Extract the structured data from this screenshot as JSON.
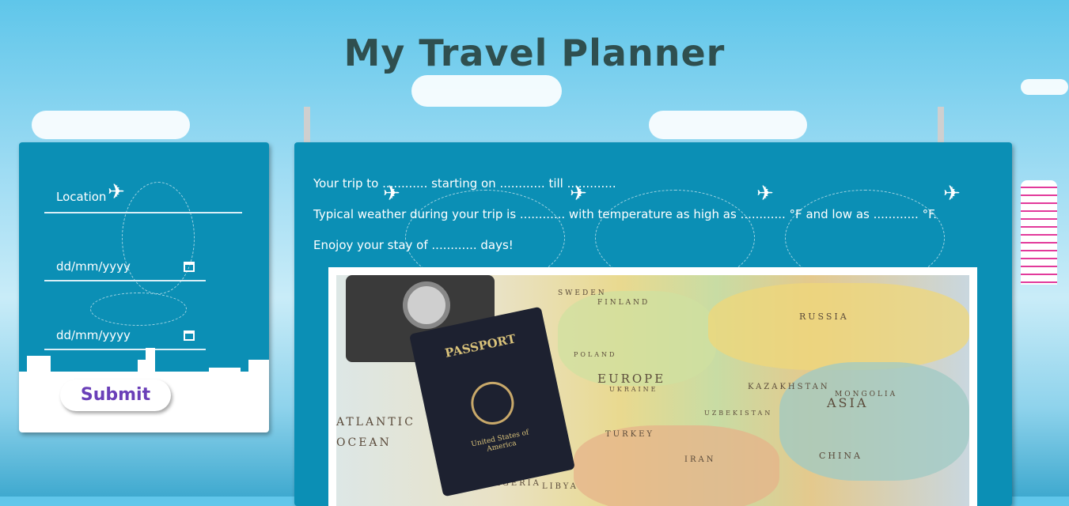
{
  "page": {
    "title": "My Travel Planner"
  },
  "form": {
    "location_placeholder": "Location",
    "start_date_placeholder": "dd/mm/yyyy",
    "end_date_placeholder": "dd/mm/yyyy",
    "submit_label": "Submit"
  },
  "summary": {
    "line1": "Your trip to ............ starting on ............ till .............",
    "line2": "Typical weather during your trip is ............ with temperature as high as ............ °F and low as ............ °F.",
    "line3": "Enojoy your stay of ............ days!"
  },
  "photo": {
    "map_labels": [
      "FINLAND",
      "SWEDEN",
      "EUROPE",
      "RUSSIA",
      "KAZAKHSTAN",
      "ASIA",
      "MONGOLIA",
      "CHINA",
      "TURKEY",
      "IRAN",
      "ATLANTIC",
      "OCEAN",
      "ALGERIA",
      "LIBYA",
      "POLAND",
      "UKRAINE",
      "UZBEKISTAN"
    ],
    "passport_title": "PASSPORT",
    "passport_country": "United States of America"
  },
  "colors": {
    "panel": "#0b8fb5",
    "title": "#2f4f4f",
    "submit_text": "#6a3fb8"
  }
}
